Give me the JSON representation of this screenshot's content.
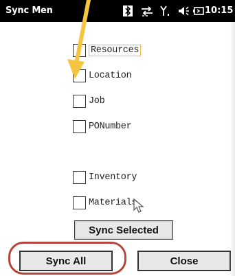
{
  "statusbar": {
    "title": "Sync Men",
    "time": "10:15",
    "icons": [
      "bluetooth-icon",
      "data-transfer-icon",
      "signal-icon",
      "volume-icon",
      "battery-icon"
    ]
  },
  "checkboxes": [
    {
      "label": "Resources",
      "checked": false,
      "focused": true
    },
    {
      "label": "Location",
      "checked": false,
      "focused": false
    },
    {
      "label": "Job",
      "checked": false,
      "focused": false
    },
    {
      "label": "PONumber",
      "checked": false,
      "focused": false
    },
    {
      "label": "Inventory",
      "checked": false,
      "focused": false
    },
    {
      "label": "Materials",
      "checked": false,
      "focused": false
    }
  ],
  "buttons": {
    "sync_selected": "Sync Selected",
    "sync_all": "Sync All",
    "close": "Close"
  },
  "colors": {
    "annotation_arrow": "#f5c542",
    "highlight_ring": "#b5453a",
    "focus_border": "#f0b840"
  }
}
